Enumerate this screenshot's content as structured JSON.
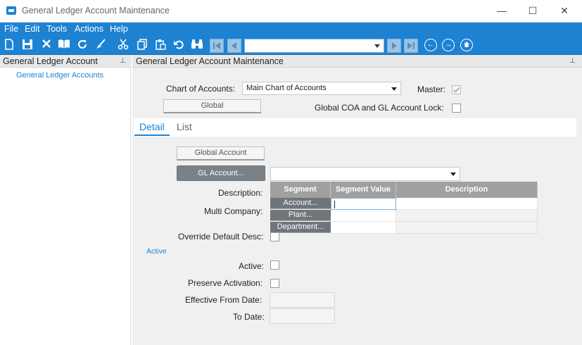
{
  "window": {
    "title": "General Ledger Account Maintenance",
    "controls": {
      "minimize": "—",
      "maximize": "☐",
      "close": "✕"
    }
  },
  "menu": [
    "File",
    "Edit",
    "Tools",
    "Actions",
    "Help"
  ],
  "toolbar": {
    "icons": [
      "new-icon",
      "save-icon",
      "delete-icon",
      "book-icon",
      "refresh-icon",
      "clear-icon",
      "cut-icon",
      "copy-icon",
      "paste-icon",
      "undo-icon",
      "search-icon"
    ],
    "nav_combo_value": "",
    "colors": {
      "menubar": "#1e82d2",
      "accent": "#1e82d2"
    }
  },
  "left_panel": {
    "title": "General Ledger Account",
    "tree_items": [
      "General Ledger Accounts"
    ]
  },
  "main": {
    "title": "General Ledger Account Maintenance",
    "chart_of_accounts": {
      "label": "Chart of Accounts:",
      "value": "Main Chart of Accounts"
    },
    "master": {
      "label": "Master:",
      "checked": true
    },
    "global_button": "Global",
    "global_lock": {
      "label": "Global COA and GL Account Lock:",
      "checked": false
    },
    "tabs": [
      {
        "label": "Detail",
        "active": true
      },
      {
        "label": "List",
        "active": false
      }
    ],
    "global_account_button": "Global Account",
    "gl_account_button": "GL Account...",
    "gl_account_value": "",
    "description_label": "Description:",
    "multi_company_label": "Multi Company:",
    "override_label": "Override Default Desc:",
    "segment_grid": {
      "headers": [
        "Segment",
        "Segment Value",
        "Description"
      ],
      "rows": [
        {
          "segment": "Account...",
          "value": "",
          "description": ""
        },
        {
          "segment": "Plant...",
          "value": "",
          "description": ""
        },
        {
          "segment": "Department...",
          "value": "",
          "description": ""
        }
      ]
    },
    "active_section": "Active",
    "active_label": "Active:",
    "preserve_label": "Preserve Activation:",
    "effective_from_label": "Effective From Date:",
    "to_date_label": "To Date:"
  }
}
